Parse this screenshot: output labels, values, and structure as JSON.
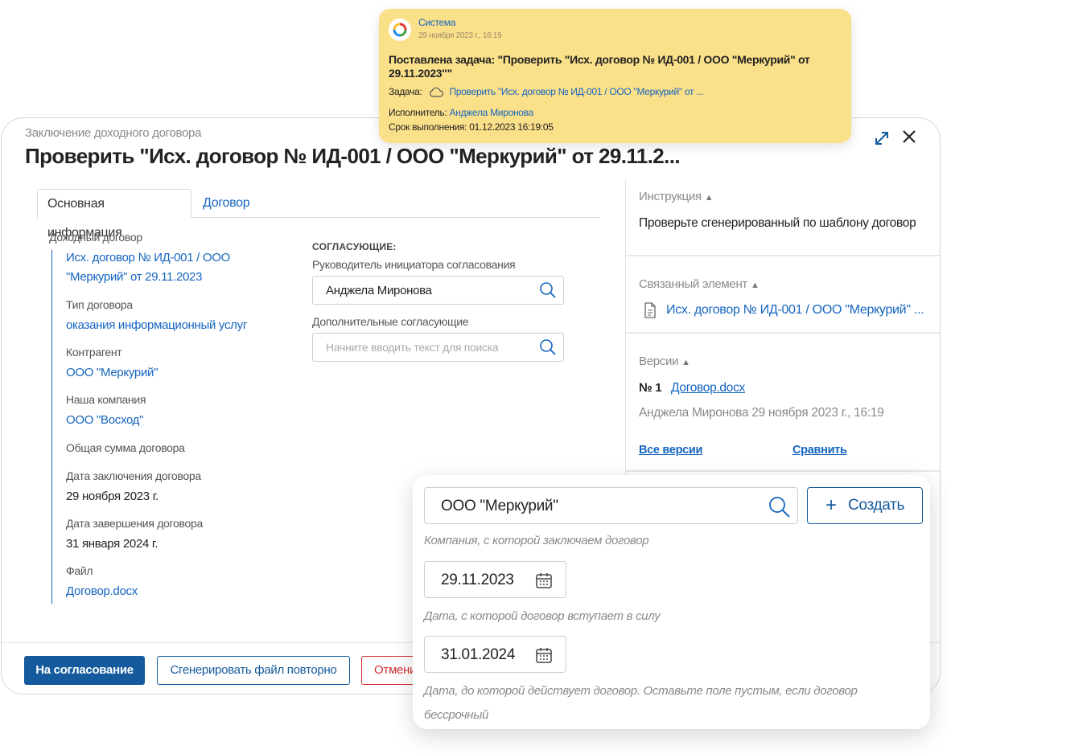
{
  "notification": {
    "sender": "Система",
    "date": "29 ноября 2023 г., 16:19",
    "title": "Поставлена задача: \"Проверить \"Исх. договор № ИД-001 / ООО \"Меркурий\" от 29.11.2023\"\"",
    "task_label": "Задача:",
    "task_link": "Проверить \"Исх. договор № ИД-001 / ООО \"Меркурий\" от ...",
    "assignee_label": "Исполнитель:",
    "assignee": "Анджела Миронова",
    "deadline_label": "Срок выполнения:",
    "deadline": "01.12.2023 16:19:05"
  },
  "dialog": {
    "subtitle": "Заключение доходного договора",
    "title": "Проверить \"Исх. договор № ИД-001 / ООО \"Меркурий\" от 29.11.2..."
  },
  "tabs": [
    {
      "label": "Основная информация"
    },
    {
      "label": "Договор"
    }
  ],
  "fields": {
    "income_contract_label": "Доходный договор",
    "income_contract_line1": "Исх. договор № ИД-001 / ООО",
    "income_contract_line2": "\"Меркурий\" от 29.11.2023",
    "type_label": "Тип договора",
    "type_value": "оказания информационный услуг",
    "counterparty_label": "Контрагент",
    "counterparty_value": "ООО \"Меркурий\"",
    "company_label": "Наша компания",
    "company_value": "ООО \"Восход\"",
    "total_label": "Общая сумма договора",
    "start_date_label": "Дата заключения договора",
    "start_date_value": "29 ноября 2023 г.",
    "end_date_label": "Дата завершения договора",
    "end_date_value": "31 января 2024 г.",
    "file_label": "Файл",
    "file_value": "Договор.docx"
  },
  "approvers": {
    "heading": "СОГЛАСУЮЩИЕ:",
    "manager_label": "Руководитель инициатора согласования",
    "manager_value": "Анджела Миронова",
    "additional_label": "Дополнительные согласующие",
    "additional_placeholder": "Начните вводить текст для поиска"
  },
  "right": {
    "instruction_title": "Инструкция",
    "instruction_text": "Проверьте сгенерированный по шаблону договор",
    "related_title": "Связанный элемент",
    "related_link": "Исх. договор № ИД-001 / ООО \"Меркурий\" ...",
    "versions_title": "Версии",
    "version_num": "№ 1",
    "version_file": "Договор.docx",
    "version_meta": "Анджела Миронова 29 ноября 2023 г., 16:19",
    "all_versions": "Все версии",
    "compare": "Сравнить"
  },
  "footer": {
    "approve_btn": "На согласование",
    "regen_btn": "Сгенерировать файл повторно",
    "cancel_btn": "Отмени"
  },
  "overlay": {
    "company_value": "ООО \"Меркурий\"",
    "create_btn": "Создать",
    "company_hint": "Компания, с которой заключаем договор",
    "start_date": "29.11.2023",
    "start_hint": "Дата, с которой договор вступает в силу",
    "end_date": "31.01.2024",
    "end_hint_1": "Дата, до которой действует договор. Оставьте поле пустым, если договор",
    "end_hint_2": "бессрочный"
  },
  "colors": {
    "accent": "#155a9c",
    "link": "#1565c0",
    "notification_bg": "#fbe08a",
    "danger": "#d32f2f"
  },
  "icons": [
    "expand-icon",
    "close-icon",
    "search-icon",
    "document-icon",
    "calendar-icon",
    "cloud-task-icon",
    "system-logo-icon",
    "plus-icon",
    "caret-up-icon"
  ]
}
